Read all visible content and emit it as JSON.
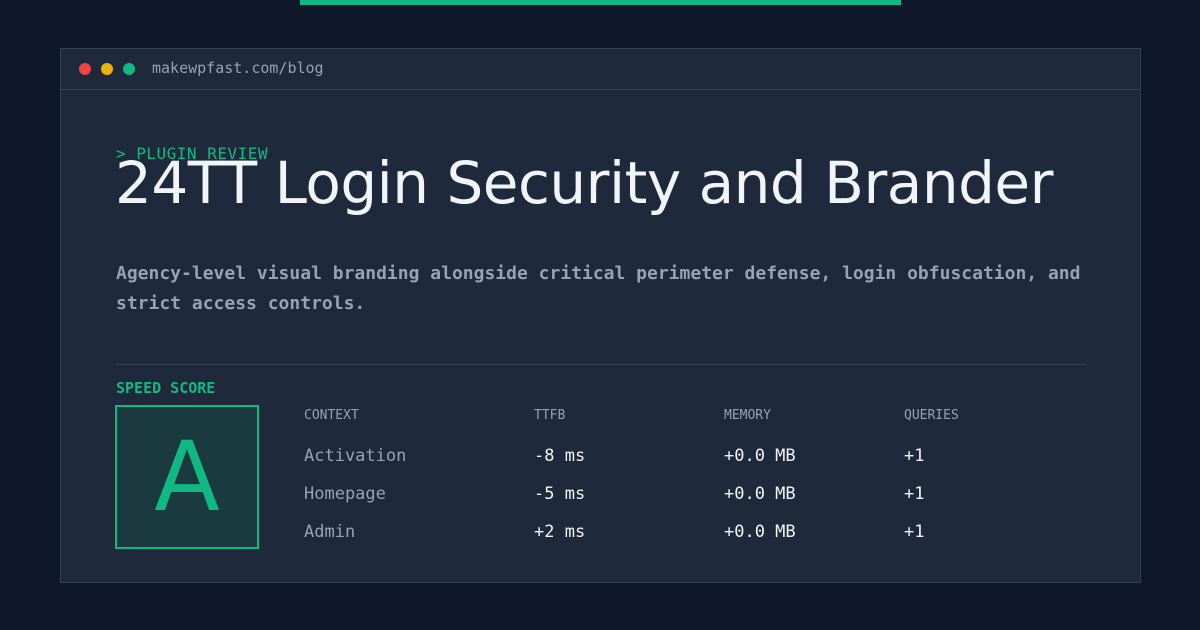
{
  "colors": {
    "background": "#0f172a",
    "card": "#1e293b",
    "accent": "#10b981",
    "muted": "#94a3b8",
    "text": "#f1f5f9",
    "dot_red": "#ef4444",
    "dot_yellow": "#eab308",
    "dot_green": "#10b981"
  },
  "window": {
    "url": "makewpfast.com/blog"
  },
  "article": {
    "kicker": "> PLUGIN REVIEW",
    "title": "24TT Login Security and Brander",
    "description": "Agency-level visual branding alongside critical perimeter defense, login obfuscation, and strict access controls."
  },
  "speed": {
    "label": "SPEED SCORE",
    "grade": "A"
  },
  "table": {
    "headers": [
      "CONTEXT",
      "TTFB",
      "MEMORY",
      "QUERIES"
    ],
    "rows": [
      [
        "Activation",
        "-8 ms",
        "+0.0 MB",
        "+1"
      ],
      [
        "Homepage",
        "-5 ms",
        "+0.0 MB",
        "+1"
      ],
      [
        "Admin",
        "+2 ms",
        "+0.0 MB",
        "+1"
      ]
    ]
  }
}
